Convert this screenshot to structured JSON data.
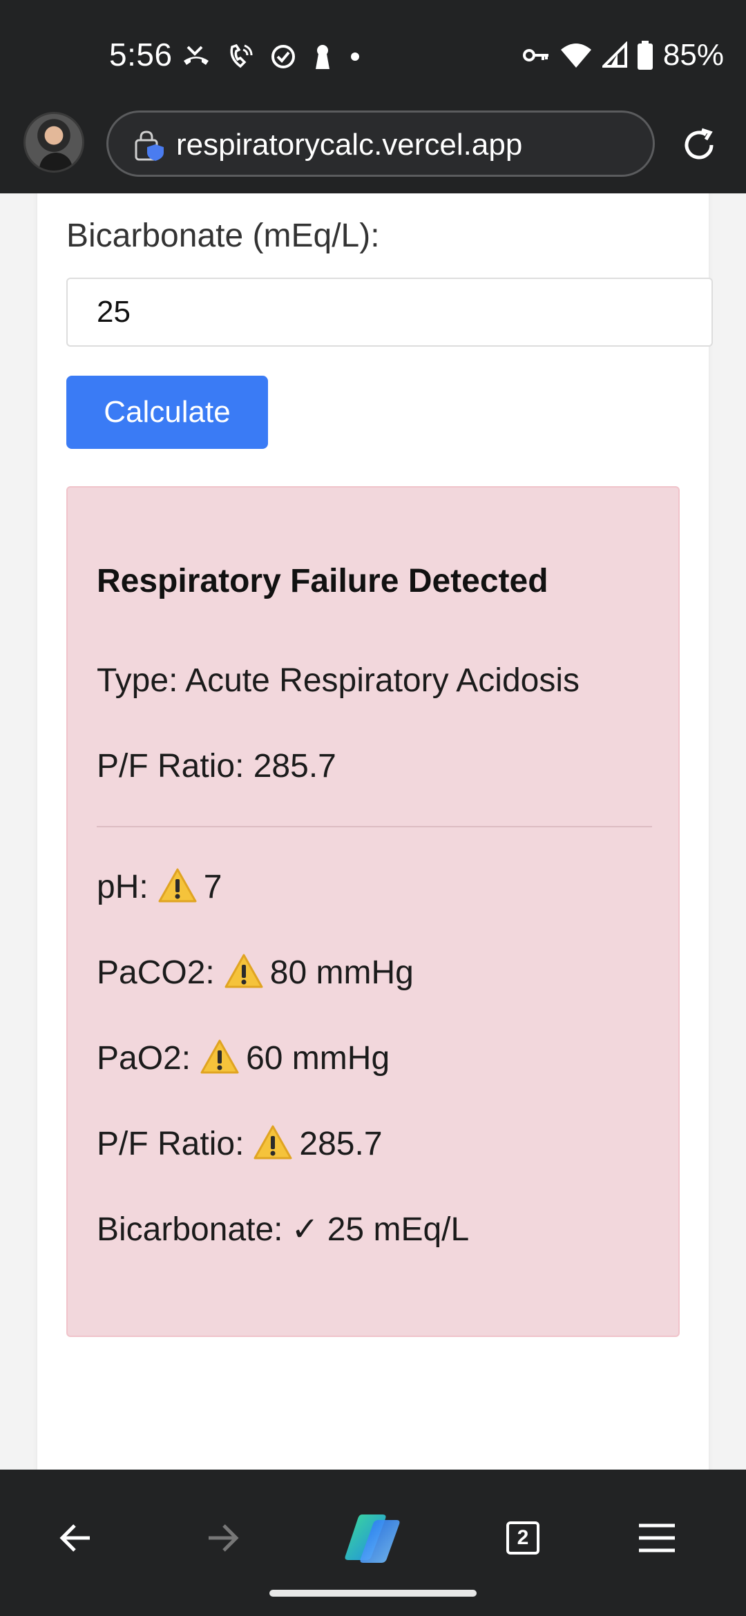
{
  "status_bar": {
    "time": "5:56",
    "battery": "85%"
  },
  "browser": {
    "url": "respiratorycalc.vercel.app",
    "tab_count": "2"
  },
  "form": {
    "bicarbonate_label": "Bicarbonate (mEq/L):",
    "bicarbonate_value": "25",
    "calculate_label": "Calculate"
  },
  "result": {
    "title": "Respiratory Failure Detected",
    "type": "Type: Acute Respiratory Acidosis",
    "pf_ratio_summary": "P/F Ratio: 285.7",
    "values": [
      {
        "label": "pH:",
        "status": "warning",
        "value": "7"
      },
      {
        "label": "PaCO2:",
        "status": "warning",
        "value": "80 mmHg"
      },
      {
        "label": "PaO2:",
        "status": "warning",
        "value": "60 mmHg"
      },
      {
        "label": "P/F Ratio:",
        "status": "warning",
        "value": "285.7"
      },
      {
        "label": "Bicarbonate:",
        "status": "normal",
        "symbol": "✓",
        "value": "25 mEq/L"
      }
    ]
  },
  "colors": {
    "result_background": "#f2d7dc",
    "button": "#3a7bf5",
    "chrome": "#222324"
  }
}
